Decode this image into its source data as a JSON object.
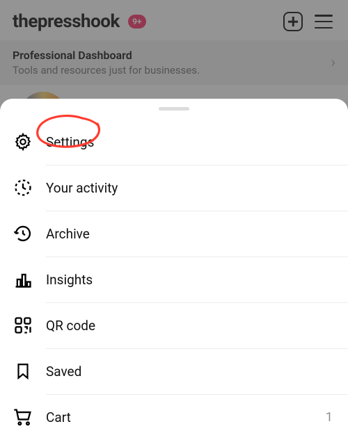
{
  "header": {
    "username": "thepresshook",
    "badge": "9+"
  },
  "dashboard": {
    "title": "Professional Dashboard",
    "subtitle": "Tools and resources just for businesses."
  },
  "menu": {
    "items": [
      {
        "label": "Settings",
        "icon": "settings",
        "trailing": ""
      },
      {
        "label": "Your activity",
        "icon": "activity",
        "trailing": ""
      },
      {
        "label": "Archive",
        "icon": "archive",
        "trailing": ""
      },
      {
        "label": "Insights",
        "icon": "insights",
        "trailing": ""
      },
      {
        "label": "QR code",
        "icon": "qrcode",
        "trailing": ""
      },
      {
        "label": "Saved",
        "icon": "saved",
        "trailing": ""
      },
      {
        "label": "Cart",
        "icon": "cart",
        "trailing": "1"
      }
    ]
  },
  "annotation": {
    "target": "Settings"
  }
}
